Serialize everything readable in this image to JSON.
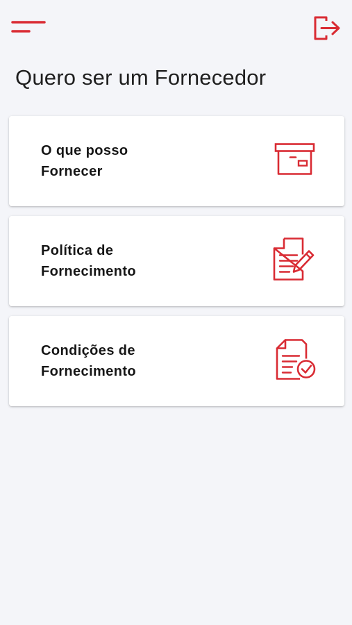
{
  "colors": {
    "accent": "#d92b33",
    "background": "#f4f5f9",
    "card": "#ffffff",
    "text": "#161616"
  },
  "header": {
    "menu_icon": "menu-icon",
    "logout_icon": "logout-icon"
  },
  "page": {
    "title": "Quero ser um Fornecedor"
  },
  "cards": [
    {
      "label": "O que posso\nFornecer",
      "icon": "archive-box-icon"
    },
    {
      "label": "Política de\nFornecimento",
      "icon": "document-edit-icon"
    },
    {
      "label": "Condições de\nFornecimento",
      "icon": "document-check-icon"
    }
  ]
}
